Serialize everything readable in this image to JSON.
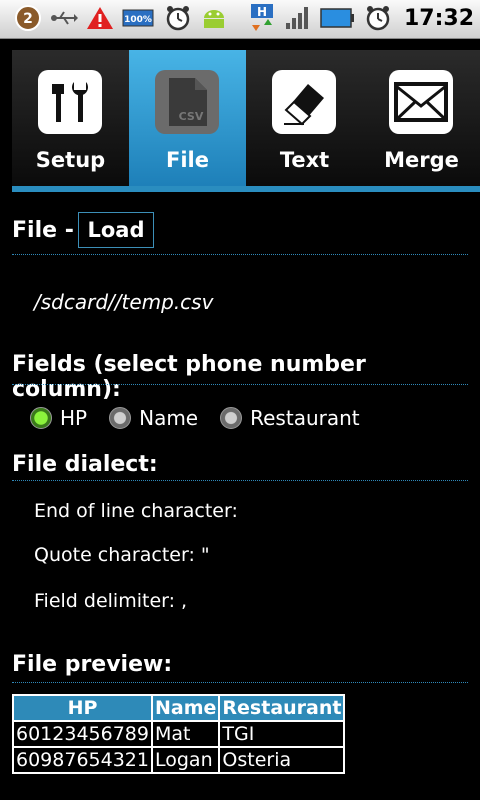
{
  "status_bar": {
    "notification_count": "2",
    "battery_label": "100%",
    "network_label": "H",
    "time": "17:32",
    "icons": [
      "notification-badge-icon",
      "usb-icon",
      "warning-icon",
      "battery-icon",
      "alarm-icon",
      "android-icon",
      "data-network-icon",
      "signal-icon",
      "battery-level-icon",
      "alarm-clock-icon"
    ]
  },
  "tabs": [
    {
      "label": "Setup",
      "icon": "tools-icon",
      "selected": false
    },
    {
      "label": "File",
      "icon": "csv-file-icon",
      "selected": true
    },
    {
      "label": "Text",
      "icon": "eraser-icon",
      "selected": false
    },
    {
      "label": "Merge",
      "icon": "envelope-icon",
      "selected": false
    }
  ],
  "file_section": {
    "title": "File -",
    "load_button": "Load",
    "path": "/sdcard//temp.csv"
  },
  "fields_section": {
    "title": "Fields (select phone number column):",
    "options": [
      {
        "label": "HP",
        "checked": true
      },
      {
        "label": "Name",
        "checked": false
      },
      {
        "label": "Restaurant",
        "checked": false
      }
    ]
  },
  "dialect_section": {
    "title": "File dialect:",
    "end_of_line": "End of line character:",
    "quote": "Quote character: \"",
    "delimiter": "Field delimiter: ,"
  },
  "preview_section": {
    "title": "File preview:",
    "headers": [
      "HP",
      "Name",
      "Restaurant"
    ],
    "rows": [
      [
        "60123456789",
        "Mat",
        "TGI"
      ],
      [
        "60987654321",
        "Logan",
        "Osteria"
      ]
    ]
  },
  "colors": {
    "accent": "#2e8ab8",
    "selected_tab": "#48b4e6",
    "radio_checked": "#8cf33c"
  }
}
